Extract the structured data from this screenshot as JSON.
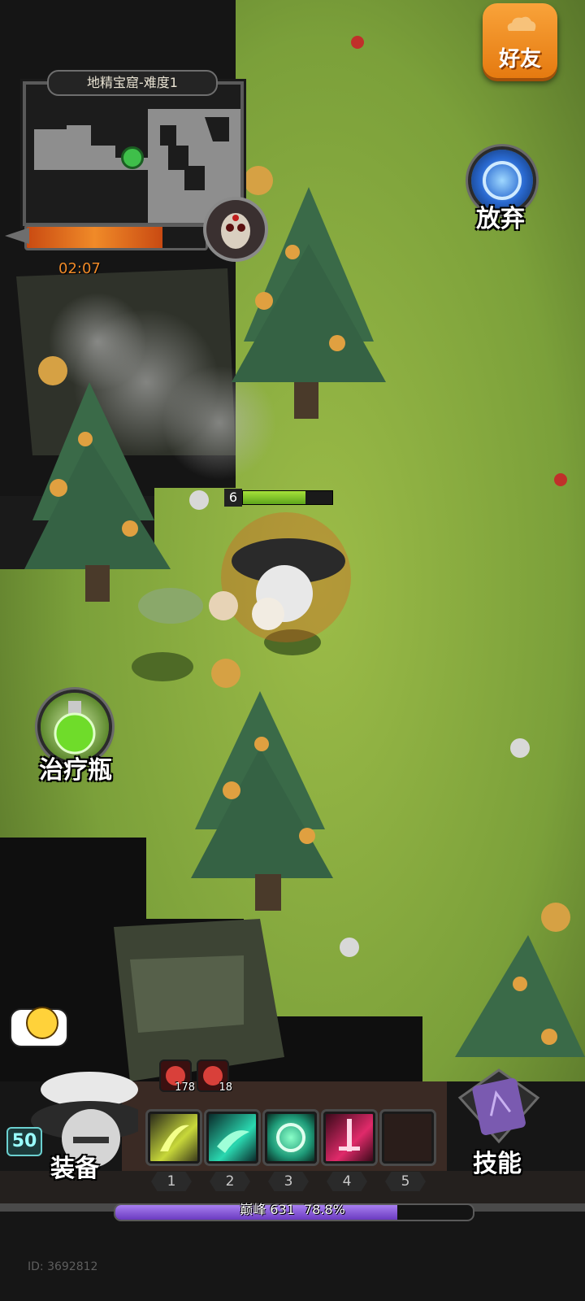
{
  "top": {
    "friends_label": "好友",
    "abandon_label": "放弃",
    "map_title": "地精宝窟-难度1",
    "timer": "02:07",
    "progress_fraction": 0.76
  },
  "player": {
    "hp_level": "6",
    "hp_fraction": 0.7
  },
  "left": {
    "potion_label": "治疗瓶"
  },
  "hud": {
    "equip_label": "装备",
    "skills_label": "技能",
    "level": "50",
    "buffs": [
      {
        "count": "178"
      },
      {
        "count": "18"
      }
    ],
    "slots": [
      "1",
      "2",
      "3",
      "4",
      "5"
    ],
    "exp_text": "巅峰 631",
    "exp_percent": "78.8%",
    "exp_fraction": 0.788,
    "user_id": "ID: 3692812"
  },
  "colors": {
    "grass": "#7ea03a",
    "dark": "#0f0f0f",
    "progress": "#e86b1c",
    "exp": "#7a4bc8",
    "friend_btn": "#f28a1c"
  }
}
